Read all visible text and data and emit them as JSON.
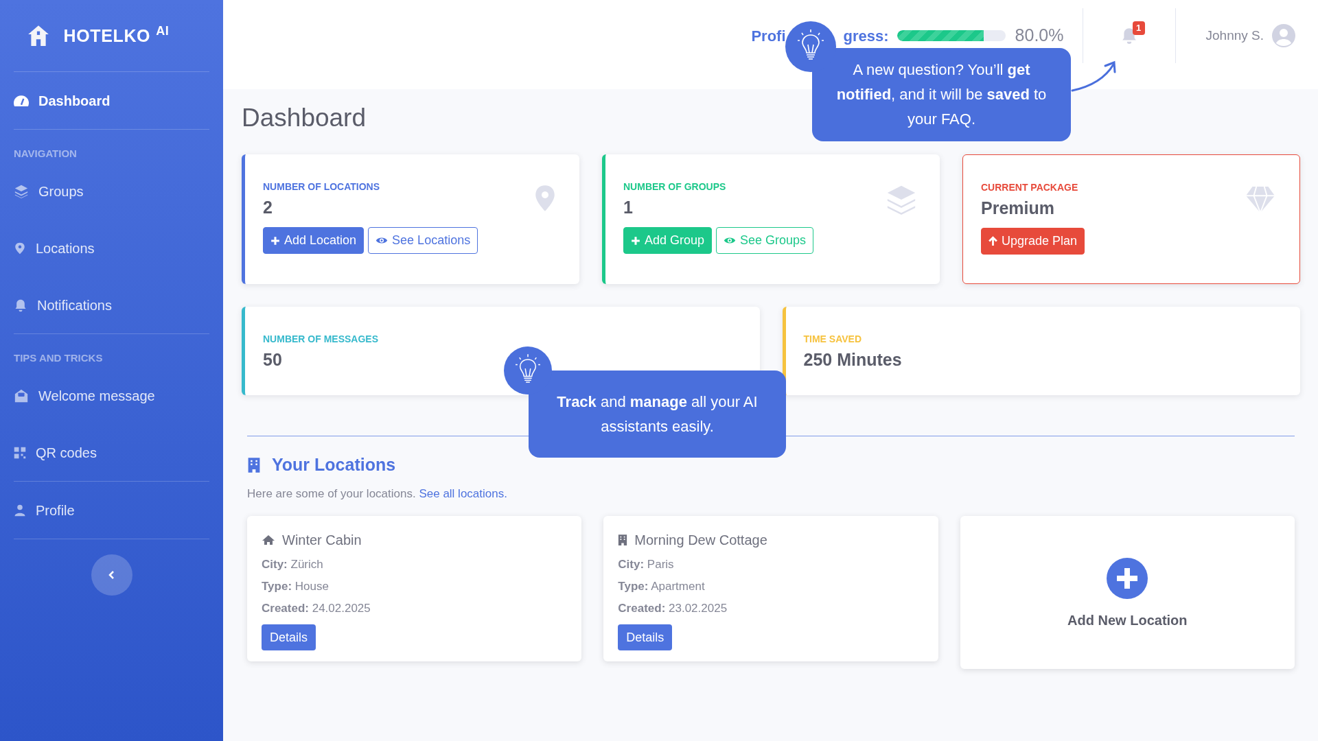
{
  "sidebar": {
    "brand": "HOTELKO",
    "brand_sup": "AI",
    "groups": [
      {
        "items": [
          {
            "label": "Dashboard",
            "selected": true
          }
        ]
      },
      {
        "heading": "NAVIGATION",
        "items": [
          {
            "label": "Groups",
            "selected": false
          },
          {
            "label": "Locations",
            "selected": false
          },
          {
            "label": "Notifications",
            "selected": false
          }
        ]
      },
      {
        "heading": "TIPS AND TRICKS",
        "items": [
          {
            "label": "Welcome message",
            "selected": false
          },
          {
            "label": "QR codes",
            "selected": false
          }
        ]
      },
      {
        "items": [
          {
            "label": "Profile",
            "selected": false
          }
        ]
      }
    ]
  },
  "header": {
    "progress": {
      "label_parts": [
        "Profi",
        "gress:"
      ],
      "level": 0.8,
      "reading": "80.0%"
    },
    "notification_count": "1",
    "user": "Johnny S."
  },
  "page_title": "Dashboard",
  "stat_cards": [
    {
      "label": "NUMBER OF LOCATIONS",
      "value": "2",
      "color": "#4e73df",
      "highlighted": false,
      "buttons": [
        {
          "kind": "add",
          "label": "Add Location"
        },
        {
          "kind": "view",
          "label": "See Locations"
        }
      ]
    },
    {
      "label": "NUMBER OF GROUPS",
      "value": "1",
      "color": "#1cc88a",
      "highlighted": false,
      "buttons": [
        {
          "kind": "add",
          "label": "Add Group"
        },
        {
          "kind": "view",
          "label": "See Groups"
        }
      ]
    },
    {
      "label": "CURRENT PACKAGE",
      "value": "Premium",
      "color": "#e74a3b",
      "highlighted": true,
      "buttons": [
        {
          "kind": "upgrade",
          "label": "Upgrade Plan"
        }
      ]
    },
    {
      "label": "NUMBER OF MESSAGES",
      "value": "50",
      "color": "#36b9cc",
      "highlighted": false
    },
    {
      "label": "TIME SAVED",
      "value": "250 Minutes",
      "color": "#f6c23e",
      "highlighted": false
    }
  ],
  "locations": {
    "title": "Your Locations",
    "subtitle": "Here are some of your locations.",
    "link": "See all locations.",
    "cards": [
      {
        "name": "Winter Cabin",
        "fields": [
          {
            "label": "City:",
            "value": "Zürich"
          },
          {
            "label": "Type:",
            "value": "House"
          },
          {
            "label": "Created:",
            "value": "24.02.2025"
          }
        ],
        "button": "Details"
      },
      {
        "name": "Morning Dew Cottage",
        "fields": [
          {
            "label": "City:",
            "value": "Paris"
          },
          {
            "label": "Type:",
            "value": "Apartment"
          },
          {
            "label": "Created:",
            "value": "23.02.2025"
          }
        ],
        "button": "Details"
      }
    ],
    "add_label": "Add New Location"
  },
  "tips": [
    {
      "text": "A new question? You’ll **get notified**, and it will be **saved** to your FAQ."
    },
    {
      "text": "**Track** and **manage** all your AI assistants easily."
    }
  ]
}
